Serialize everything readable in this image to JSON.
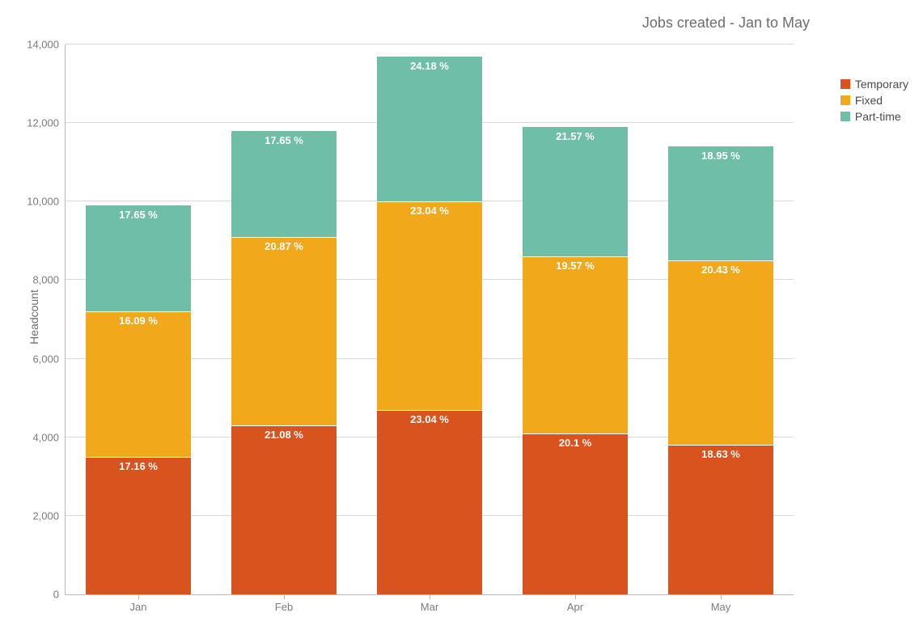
{
  "chart_data": {
    "type": "bar",
    "stacked": true,
    "title": "Jobs created - Jan to May",
    "xlabel": "",
    "ylabel": "Headcount",
    "ylim": [
      0,
      14000
    ],
    "yticks": [
      0,
      2000,
      4000,
      6000,
      8000,
      10000,
      12000,
      14000
    ],
    "ytick_labels": [
      "0",
      "2,000",
      "4,000",
      "6,000",
      "8,000",
      "10,000",
      "12,000",
      "14,000"
    ],
    "categories": [
      "Jan",
      "Feb",
      "Mar",
      "Apr",
      "May"
    ],
    "series": [
      {
        "name": "Temporary",
        "color": "#d9531e",
        "values": [
          3500,
          4300,
          4700,
          4100,
          3800
        ],
        "data_labels": [
          "17.16 %",
          "21.08 %",
          "23.04 %",
          "20.1 %",
          "18.63 %"
        ]
      },
      {
        "name": "Fixed",
        "color": "#f1a81b",
        "values": [
          3700,
          4800,
          5300,
          4500,
          4700
        ],
        "data_labels": [
          "16.09 %",
          "20.87 %",
          "23.04 %",
          "19.57 %",
          "20.43 %"
        ]
      },
      {
        "name": "Part-time",
        "color": "#6fbfa8",
        "values": [
          2700,
          2700,
          3700,
          3300,
          2900
        ],
        "data_labels": [
          "17.65 %",
          "17.65 %",
          "24.18 %",
          "21.57 %",
          "18.95 %"
        ]
      }
    ],
    "legend": {
      "position": "right",
      "items": [
        "Temporary",
        "Fixed",
        "Part-time"
      ]
    }
  }
}
